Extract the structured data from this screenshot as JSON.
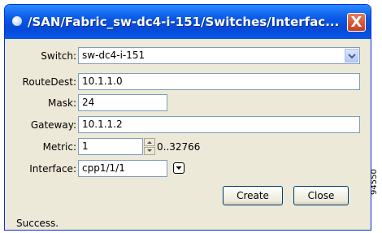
{
  "window": {
    "title": "/SAN/Fabric_sw-dc4-i-151/Switches/Interfac...",
    "close_glyph": "X"
  },
  "form": {
    "switch": {
      "label": "Switch:",
      "value": "sw-dc4-i-151"
    },
    "routedest": {
      "label": "RouteDest:",
      "value": "10.1.1.0"
    },
    "mask": {
      "label": "Mask:",
      "value": "24"
    },
    "gateway": {
      "label": "Gateway:",
      "value": "10.1.1.2"
    },
    "metric": {
      "label": "Metric:",
      "value": "1",
      "range": "0..32766"
    },
    "interface": {
      "label": "Interface:",
      "value": "cpp1/1/1"
    }
  },
  "buttons": {
    "create": "Create",
    "close": "Close"
  },
  "status": "Success.",
  "watermark": "94550",
  "colors": {
    "titlebar": "#0a58e6",
    "close_button": "#d5512c",
    "field_border": "#7f9db9"
  },
  "icons": [
    "window-icon",
    "close-icon",
    "dropdown-arrow-icon",
    "spinner-up-icon",
    "spinner-down-icon",
    "interface-picker-icon"
  ]
}
